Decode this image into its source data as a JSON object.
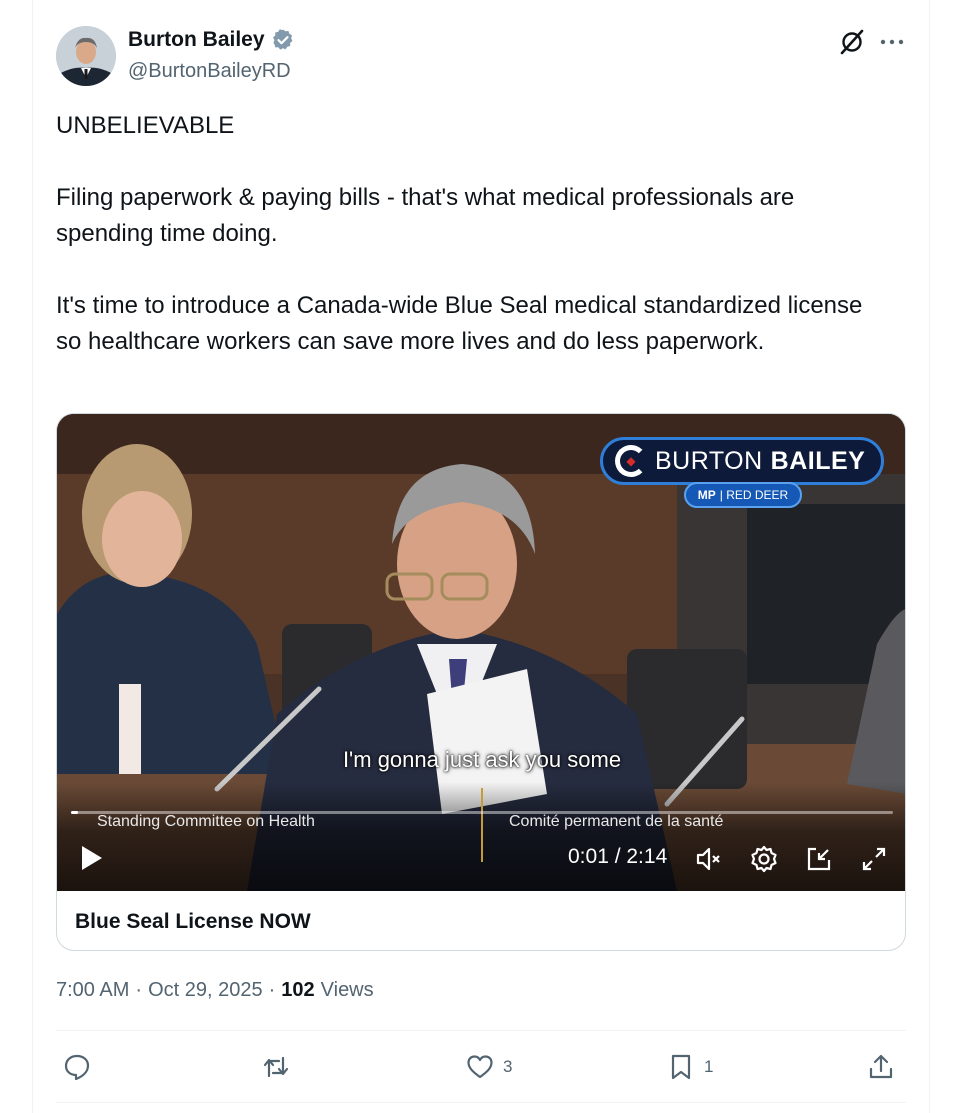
{
  "author": {
    "display_name": "Burton Bailey",
    "handle": "@BurtonBaileyRD"
  },
  "tweet": {
    "paragraphs": [
      "UNBELIEVABLE",
      "Filing paperwork & paying bills - that's what medical professionals are spending time doing.",
      "It's time to introduce a Canada-wide Blue Seal medical standardized license so healthcare workers can save more lives and do less paperwork."
    ]
  },
  "video": {
    "logo_name_regular": "BURTON",
    "logo_name_bold": "BAILEY",
    "logo_sub_mp": "MP",
    "logo_sub_place": "| RED DEER",
    "caption": "I'm gonna just ask you some",
    "lower_third_en": "Standing Committee on Health",
    "lower_third_fr": "Comité permanent de la santé",
    "time_display": "0:01 / 2:14",
    "progress_fraction": 0.008
  },
  "card": {
    "title": "Blue Seal License NOW"
  },
  "meta": {
    "time": "7:00 AM",
    "separator": "·",
    "date": "Oct 29, 2025",
    "views_count": "102",
    "views_label": "Views"
  },
  "actions": {
    "reply_count": "",
    "repost_count": "",
    "like_count": "3",
    "bookmark_count": "1"
  },
  "icons": {
    "verified": "verified-badge-icon",
    "grok": "grok-icon",
    "more": "more-icon",
    "play": "play-icon",
    "mute": "muted-speaker-icon",
    "settings": "gear-icon",
    "pip": "picture-in-picture-icon",
    "fullscreen": "expand-icon"
  },
  "colors": {
    "text_primary": "#0f1419",
    "text_secondary": "#536471",
    "border": "#cfd9de",
    "logo_blue": "#2f7fd8",
    "maple_red": "#d82c2c"
  }
}
